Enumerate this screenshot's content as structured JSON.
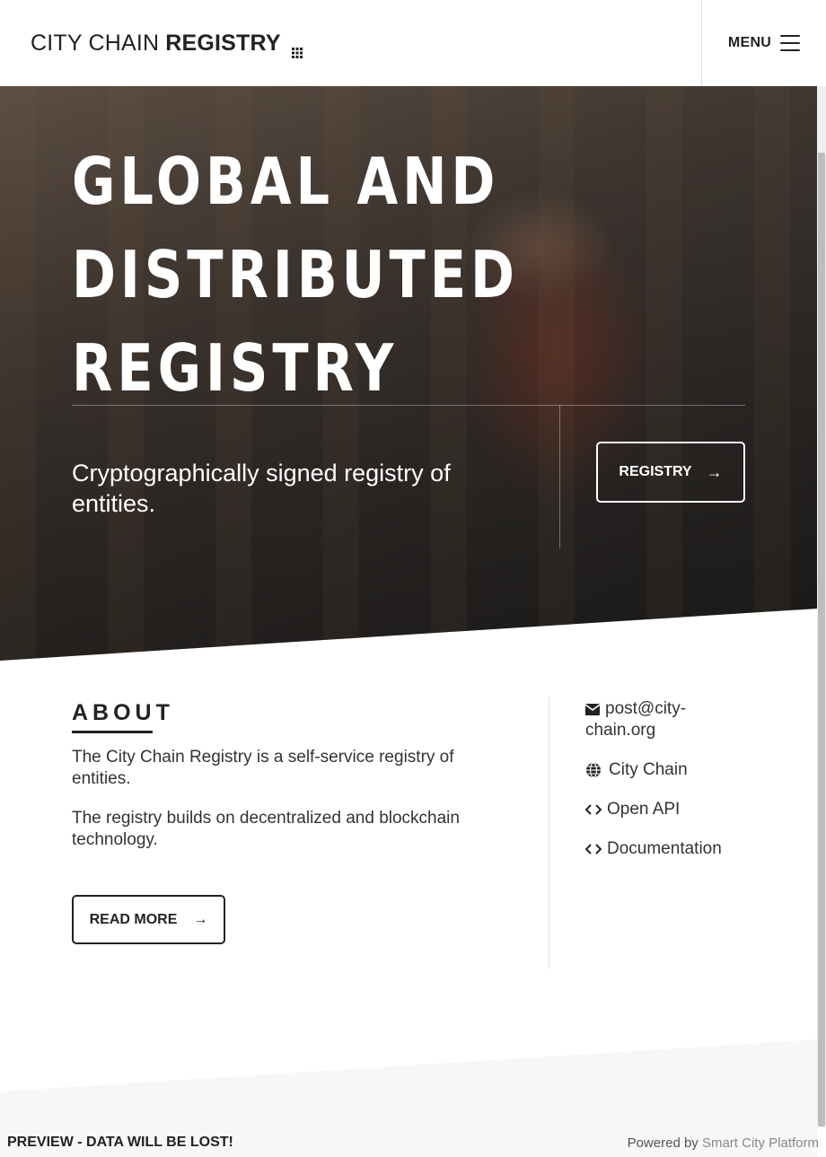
{
  "header": {
    "brand_light": "CITY CHAIN",
    "brand_bold": "REGISTRY",
    "menu_label": "MENU"
  },
  "hero": {
    "title_lines": [
      "GLOBAL AND",
      "DISTRIBUTED",
      "REGISTRY"
    ],
    "subtitle": "Cryptographically signed registry of entities.",
    "button_label": "REGISTRY"
  },
  "about": {
    "title": "ABOUT",
    "paragraphs": [
      "The City Chain Registry is a self-service registry of entities.",
      "The registry builds on decentralized and blockchain technology."
    ],
    "read_more_label": "READ MORE"
  },
  "links": {
    "email": "post@city-chain.org",
    "city_chain": "City Chain",
    "open_api": "Open API",
    "documentation": "Documentation"
  },
  "footer": {
    "warning": "PREVIEW - DATA WILL BE LOST!",
    "powered_by": "Powered by",
    "platform": "Smart City Platform"
  },
  "icons": {
    "brand": "grid-icon",
    "menu": "hamburger-icon",
    "arrow": "arrow-right-icon",
    "email": "envelope-icon",
    "city_chain": "globe-icon",
    "api": "code-icon",
    "docs": "code-icon"
  }
}
